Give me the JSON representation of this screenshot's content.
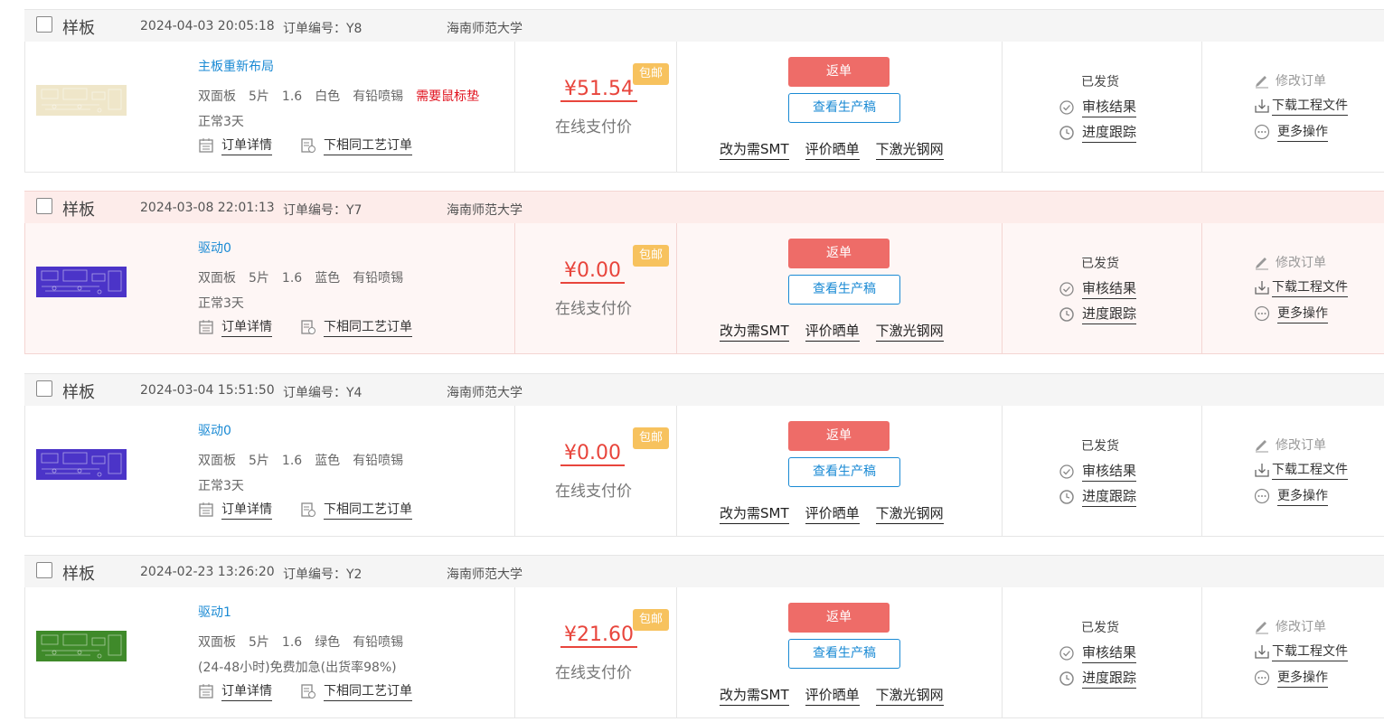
{
  "orders": [
    {
      "type": "样板",
      "datetime": "2024-04-03 20:05:18",
      "order_no": "订单编号：Y8",
      "school": "海南师范大学",
      "board_color": "#efe6c9",
      "product_name": "主板重新布局",
      "specs": [
        "双面板",
        "5片",
        "1.6",
        "白色",
        "有铅喷锡"
      ],
      "warning": "需要鼠标垫",
      "delivery": "正常3天",
      "price": "¥51.54",
      "badge": "包邮",
      "pay_label": "在线支付价",
      "status": "已发货"
    },
    {
      "type": "样板",
      "datetime": "2024-03-08 22:01:13",
      "order_no": "订单编号：Y7",
      "school": "海南师范大学",
      "board_color": "#4b34c8",
      "product_name": "驱动0",
      "specs": [
        "双面板",
        "5片",
        "1.6",
        "蓝色",
        "有铅喷锡"
      ],
      "warning": "",
      "delivery": "正常3天",
      "price": "¥0.00",
      "badge": "包邮",
      "pay_label": "在线支付价",
      "status": "已发货"
    },
    {
      "type": "样板",
      "datetime": "2024-03-04 15:51:50",
      "order_no": "订单编号：Y4",
      "school": "海南师范大学",
      "board_color": "#4b34c8",
      "product_name": "驱动0",
      "specs": [
        "双面板",
        "5片",
        "1.6",
        "蓝色",
        "有铅喷锡"
      ],
      "warning": "",
      "delivery": "正常3天",
      "price": "¥0.00",
      "badge": "包邮",
      "pay_label": "在线支付价",
      "status": "已发货"
    },
    {
      "type": "样板",
      "datetime": "2024-02-23 13:26:20",
      "order_no": "订单编号：Y2",
      "school": "海南师范大学",
      "board_color": "#3f8a2a",
      "product_name": "驱动1",
      "specs": [
        "双面板",
        "5片",
        "1.6",
        "绿色",
        "有铅喷锡"
      ],
      "warning": "",
      "delivery": "(24-48小时)免费加急(出货率98%)",
      "price": "¥21.60",
      "badge": "包邮",
      "pay_label": "在线支付价",
      "status": "已发货"
    }
  ],
  "labels": {
    "order_detail": "订单详情",
    "same_process": "下相同工艺订单",
    "return_order": "返单",
    "view_production": "查看生产稿",
    "change_smt": "改为需SMT",
    "review": "评价晒单",
    "laser_stencil": "下激光钢网",
    "audit_result": "审核结果",
    "progress": "进度跟踪",
    "edit_order": "修改订单",
    "download_files": "下载工程文件",
    "more_actions": "更多操作"
  },
  "colors": {
    "accent_blue": "#1a8ad4",
    "price_red": "#e8453c",
    "button_red": "#ee6c68",
    "badge_yellow": "#f7c25e",
    "highlight_row": "#fdecea"
  }
}
